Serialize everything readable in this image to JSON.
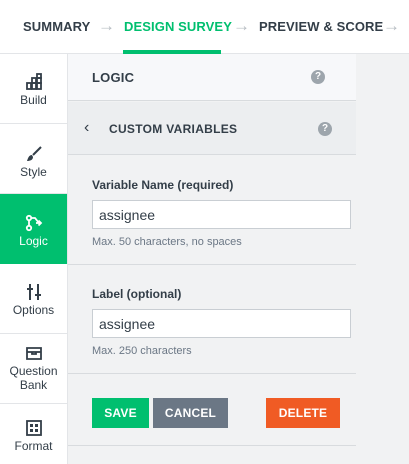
{
  "steps": [
    {
      "label": "SUMMARY"
    },
    {
      "label": "DESIGN SURVEY"
    },
    {
      "label": "PREVIEW & SCORE"
    }
  ],
  "step_separator": "→",
  "active_step": "DESIGN SURVEY",
  "sidebar": {
    "items": [
      {
        "label": "Build",
        "icon": "build-icon"
      },
      {
        "label": "Style",
        "icon": "brush-icon"
      },
      {
        "label": "Logic",
        "icon": "logic-icon"
      },
      {
        "label": "Options",
        "icon": "sliders-icon"
      },
      {
        "label": "Question Bank",
        "icon": "question-bank-icon"
      },
      {
        "label": "Format",
        "icon": "format-icon"
      }
    ],
    "active": "Logic"
  },
  "panel": {
    "title": "LOGIC",
    "help": "?",
    "sub_title": "CUSTOM VARIABLES",
    "back": "‹",
    "variable_name": {
      "label": "Variable Name (required)",
      "value": "assignee",
      "hint": "Max. 50 characters, no spaces"
    },
    "variable_label": {
      "label": "Label (optional)",
      "value": "assignee",
      "hint": "Max. 250 characters"
    },
    "buttons": {
      "save": "SAVE",
      "cancel": "CANCEL",
      "delete": "DELETE"
    }
  },
  "colors": {
    "accent": "#00bf6f",
    "cancel": "#6b7785",
    "delete": "#f05b24",
    "panel_bg": "#f1f2f3"
  }
}
